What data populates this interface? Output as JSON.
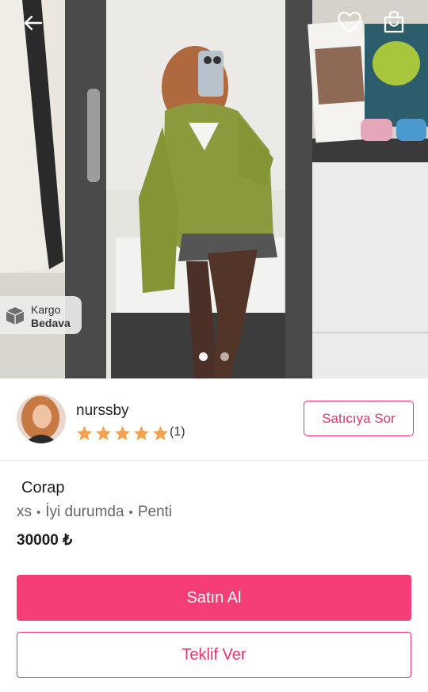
{
  "hero": {
    "image": "product-photo-mirror-selfie",
    "shipping_badge": {
      "line1": "Kargo",
      "line2": "Bedava",
      "icon": "box-icon"
    },
    "carousel": {
      "count": 2,
      "active_index": 0
    },
    "nav": {
      "back_icon": "arrow-left-icon",
      "favorite_icon": "heart-icon",
      "cart_icon": "shopping-bag-icon"
    }
  },
  "seller": {
    "name": "nurssby",
    "rating": 5,
    "rating_count": "(1)",
    "ask_label": "Satıcıya Sor"
  },
  "product": {
    "title": "Corap",
    "size": "xs",
    "condition": "İyi durumda",
    "brand": "Penti",
    "separator": "•",
    "price": "30000 ₺"
  },
  "actions": {
    "buy_label": "Satın Al",
    "offer_label": "Teklif Ver"
  },
  "colors": {
    "accent": "#f53d76",
    "accent_border": "#e8336e"
  }
}
